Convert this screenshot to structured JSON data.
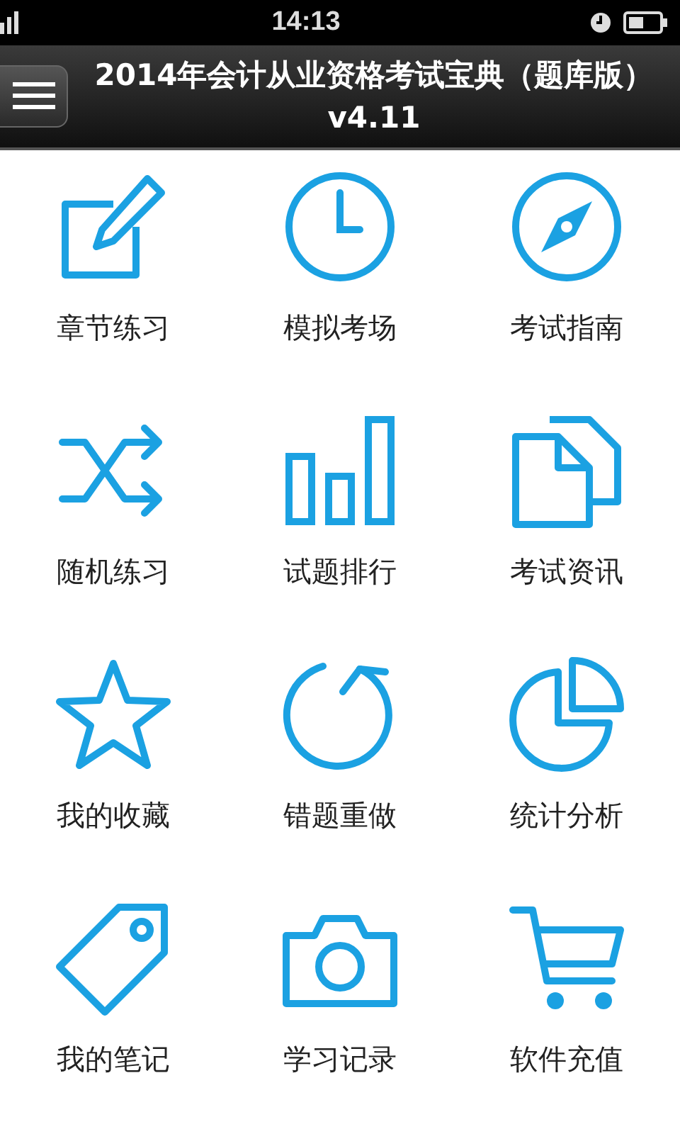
{
  "status_bar": {
    "time": "14:13"
  },
  "title_bar": {
    "title": "2014年会计从业资格考试宝典（题库版）v4.11"
  },
  "menu": [
    {
      "label": "章节练习"
    },
    {
      "label": "模拟考场"
    },
    {
      "label": "考试指南"
    },
    {
      "label": "随机练习"
    },
    {
      "label": "试题排行"
    },
    {
      "label": "考试资讯"
    },
    {
      "label": "我的收藏"
    },
    {
      "label": "错题重做"
    },
    {
      "label": "统计分析"
    },
    {
      "label": "我的笔记"
    },
    {
      "label": "学习记录"
    },
    {
      "label": "软件充值"
    }
  ]
}
